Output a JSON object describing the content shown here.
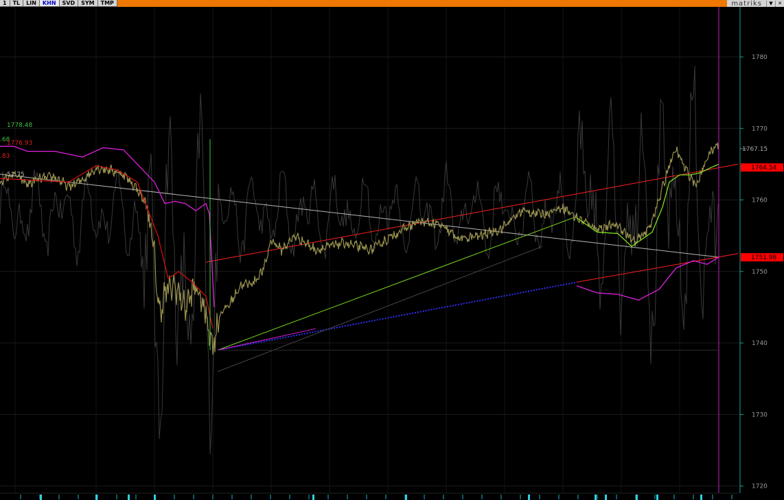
{
  "toolbar": {
    "buttons": [
      {
        "label": "1",
        "active": false
      },
      {
        "label": "TL",
        "active": false
      },
      {
        "label": "LIN",
        "active": false
      },
      {
        "label": "KHN",
        "active": true
      },
      {
        "label": "SVD",
        "active": false
      },
      {
        "label": "SYM",
        "active": false
      },
      {
        "label": "TMP",
        "active": false
      }
    ],
    "brand": "matriks"
  },
  "colors": {
    "background": "#000000",
    "price": "#9a9350",
    "ma_red": "#d01010",
    "band_magenta": "#e020e0",
    "trend_red": "#ff2020",
    "trend_white": "#b8b8b8",
    "trend_green": "#80e020",
    "trend_blue": "#3030ff",
    "oscillator": "#3a3a3a",
    "axis_line": "#18a0a0",
    "tag_red": "#ff0000",
    "vline_magenta": "#c020c0",
    "vline_green": "#40d040"
  },
  "chart_data": {
    "type": "line",
    "xlabel": "",
    "ylabel": "",
    "ylim": [
      1719,
      1787
    ],
    "y_ticks": [
      1720,
      1730,
      1740,
      1750,
      1760,
      1770,
      1780
    ],
    "grid": true,
    "left_notes": [
      {
        "text": ".68",
        "color": "#40c040",
        "value": 1768.5
      },
      {
        "text": "1778.48",
        "color": "#40c040",
        "value": 1770.5
      },
      {
        "text": ".83",
        "color": "#e02020",
        "value": 1766.2
      },
      {
        "text": "1776.93",
        "color": "#e02020",
        "value": 1768.0
      },
      {
        "text": "51.75",
        "color": "#b8b8b8",
        "value": 1763.6
      }
    ],
    "price_tags": [
      {
        "text": "1767.15",
        "value": 1767.15,
        "style": "plain"
      },
      {
        "text": "1764.54",
        "value": 1764.54,
        "style": "red"
      },
      {
        "text": "1751.98",
        "value": 1751.98,
        "style": "red"
      }
    ],
    "n_bars": 1050,
    "series": [
      {
        "role": "price",
        "color": "#9a9350",
        "keypoints": [
          [
            0,
            1762.5
          ],
          [
            20,
            1763.6
          ],
          [
            40,
            1762.2
          ],
          [
            60,
            1763.0
          ],
          [
            80,
            1763.2
          ],
          [
            100,
            1761.8
          ],
          [
            120,
            1762.8
          ],
          [
            140,
            1764.5
          ],
          [
            160,
            1764.2
          ],
          [
            180,
            1763.6
          ],
          [
            200,
            1761.5
          ],
          [
            215,
            1759.0
          ],
          [
            225,
            1752.0
          ],
          [
            232,
            1744.0
          ],
          [
            240,
            1747.0
          ],
          [
            255,
            1748.0
          ],
          [
            270,
            1745.0
          ],
          [
            285,
            1748.0
          ],
          [
            300,
            1744.0
          ],
          [
            310,
            1739.5
          ],
          [
            320,
            1744.0
          ],
          [
            335,
            1745.5
          ],
          [
            350,
            1748.0
          ],
          [
            370,
            1748.5
          ],
          [
            385,
            1750.5
          ],
          [
            395,
            1754.5
          ],
          [
            410,
            1753.0
          ],
          [
            430,
            1755.0
          ],
          [
            460,
            1753.0
          ],
          [
            500,
            1754.0
          ],
          [
            540,
            1753.0
          ],
          [
            580,
            1755.5
          ],
          [
            610,
            1757.0
          ],
          [
            640,
            1756.5
          ],
          [
            670,
            1754.5
          ],
          [
            700,
            1755.0
          ],
          [
            730,
            1756.0
          ],
          [
            760,
            1758.5
          ],
          [
            790,
            1758.0
          ],
          [
            820,
            1759.0
          ],
          [
            840,
            1757.5
          ],
          [
            870,
            1756.0
          ],
          [
            900,
            1756.5
          ],
          [
            925,
            1754.0
          ],
          [
            945,
            1756.0
          ],
          [
            960,
            1760.0
          ],
          [
            975,
            1765.0
          ],
          [
            985,
            1767.0
          ],
          [
            1000,
            1764.0
          ],
          [
            1015,
            1762.0
          ],
          [
            1030,
            1766.0
          ],
          [
            1047,
            1768.0
          ]
        ]
      },
      {
        "role": "ma",
        "color": "#d01010",
        "keypoints": [
          [
            0,
            1763.0
          ],
          [
            40,
            1762.8
          ],
          [
            100,
            1762.5
          ],
          [
            140,
            1764.8
          ],
          [
            170,
            1764.2
          ],
          [
            200,
            1762.5
          ],
          [
            230,
            1755.0
          ],
          [
            245,
            1749.0
          ],
          [
            260,
            1750.0
          ],
          [
            280,
            1748.5
          ],
          [
            300,
            1746.5
          ],
          [
            310,
            1742.0
          ]
        ]
      },
      {
        "role": "band",
        "color": "#e020e0",
        "keypoints": [
          [
            0,
            1767.5
          ],
          [
            20,
            1767.5
          ],
          [
            40,
            1766.8
          ],
          [
            80,
            1766.8
          ],
          [
            120,
            1766.0
          ],
          [
            150,
            1767.3
          ],
          [
            180,
            1767.0
          ],
          [
            205,
            1764.5
          ],
          [
            225,
            1762.5
          ],
          [
            240,
            1759.5
          ],
          [
            255,
            1759.8
          ],
          [
            270,
            1759.5
          ],
          [
            285,
            1758.5
          ],
          [
            300,
            1759.5
          ],
          [
            305,
            1758.0
          ],
          [
            312,
            1745.0
          ]
        ]
      },
      {
        "role": "band_lower",
        "color": "#e020e0",
        "keypoints": [
          [
            840,
            1748.0
          ],
          [
            870,
            1747.0
          ],
          [
            900,
            1746.8
          ],
          [
            930,
            1746.0
          ],
          [
            960,
            1747.5
          ],
          [
            985,
            1750.5
          ],
          [
            1010,
            1751.5
          ],
          [
            1030,
            1751.0
          ],
          [
            1047,
            1752.0
          ]
        ]
      },
      {
        "role": "ma_green",
        "color": "#80e020",
        "keypoints": [
          [
            840,
            1757.5
          ],
          [
            870,
            1755.5
          ],
          [
            900,
            1755.3
          ],
          [
            920,
            1753.5
          ],
          [
            935,
            1754.5
          ],
          [
            950,
            1755.5
          ],
          [
            965,
            1759.0
          ],
          [
            975,
            1762.5
          ],
          [
            990,
            1763.5
          ],
          [
            1005,
            1763.5
          ],
          [
            1020,
            1763.8
          ],
          [
            1035,
            1764.5
          ],
          [
            1047,
            1765.0
          ]
        ]
      }
    ],
    "trendlines": [
      {
        "color": "#b8b8b8",
        "from": [
          0,
          1763.6
        ],
        "to": [
          1047,
          1752.0
        ]
      },
      {
        "color": "#ff2020",
        "from": [
          300,
          1751.3
        ],
        "to": [
          1075,
          1765.0
        ]
      },
      {
        "color": "#ff2020",
        "from": [
          840,
          1748.5
        ],
        "to": [
          1075,
          1752.5
        ]
      },
      {
        "color": "#80e020",
        "from": [
          317,
          1739.0
        ],
        "to": [
          835,
          1757.5
        ]
      },
      {
        "color": "#3030ff",
        "from": [
          317,
          1739.0
        ],
        "to": [
          840,
          1748.5
        ],
        "dotted": true
      },
      {
        "color": "#e020e0",
        "from": [
          317,
          1739.0
        ],
        "to": [
          460,
          1742.0
        ]
      }
    ],
    "vlines": [
      {
        "color": "#40d040",
        "x": 306
      },
      {
        "color": "#c020c0",
        "x": 1047
      }
    ]
  }
}
